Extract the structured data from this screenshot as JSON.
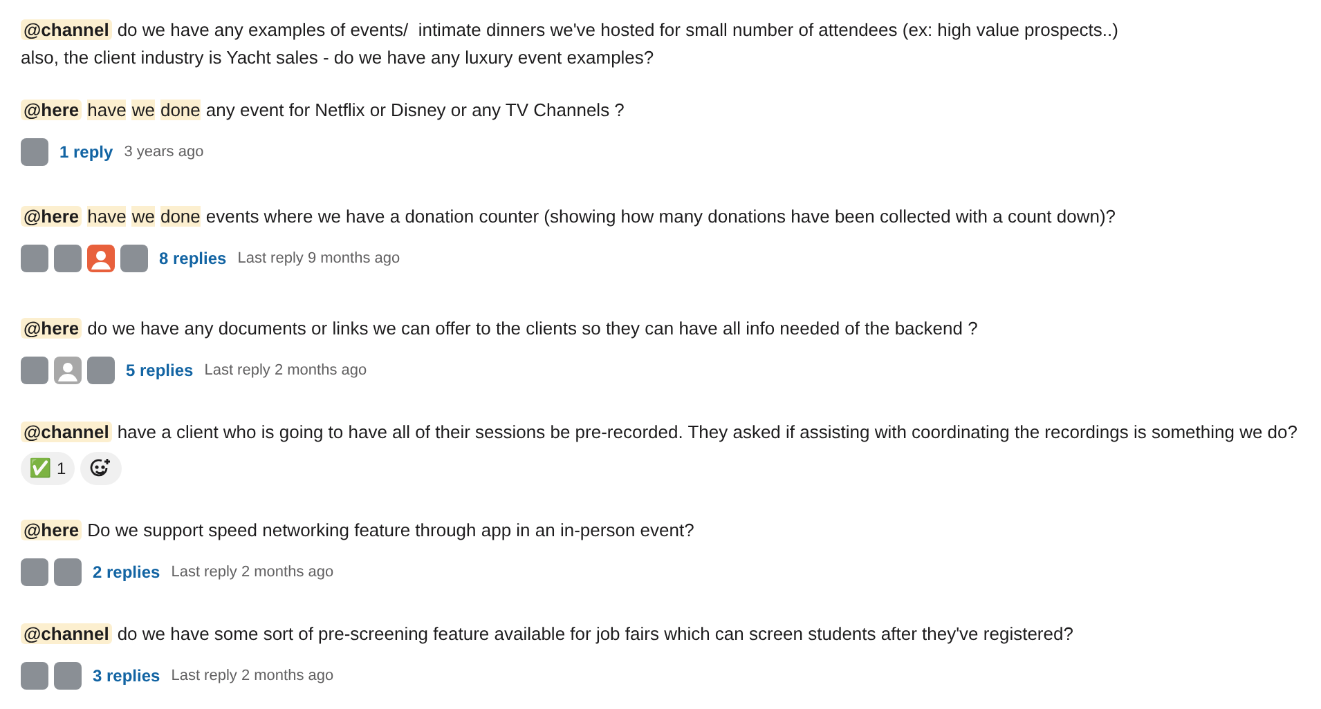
{
  "messages": [
    {
      "segments": [
        {
          "kind": "mention",
          "text": "@channel"
        },
        {
          "kind": "text",
          "text": "do we have any examples of events/  intimate dinners we've hosted for small number of attendees (ex: high value prospects..)\nalso, the client industry is Yacht sales - do we have any luxury event examples?"
        }
      ]
    },
    {
      "segments": [
        {
          "kind": "mention",
          "text": "@here"
        },
        {
          "kind": "highlight",
          "text": "have"
        },
        {
          "kind": "highlight",
          "text": "we"
        },
        {
          "kind": "highlight",
          "text": "done"
        },
        {
          "kind": "text",
          "text": "any event for Netflix or Disney or any TV Channels ?"
        }
      ],
      "thread": {
        "avatars": [
          {
            "kind": "photo"
          }
        ],
        "count": "1 reply",
        "last_reply": "3 years ago"
      }
    },
    {
      "segments": [
        {
          "kind": "mention",
          "text": "@here"
        },
        {
          "kind": "highlight",
          "text": "have"
        },
        {
          "kind": "highlight",
          "text": "we"
        },
        {
          "kind": "highlight",
          "text": "done"
        },
        {
          "kind": "text",
          "text": "events where we have a donation counter (showing how many donations have been collected with a count down)?"
        }
      ],
      "thread": {
        "avatars": [
          {
            "kind": "photo"
          },
          {
            "kind": "photo"
          },
          {
            "kind": "default",
            "color": "#e8603c"
          },
          {
            "kind": "photo"
          }
        ],
        "count": "8 replies",
        "last_reply": "Last reply 9 months ago"
      }
    },
    {
      "segments": [
        {
          "kind": "mention",
          "text": "@here"
        },
        {
          "kind": "text",
          "text": "do we have any documents or links we can offer to the clients so they can have all info needed of the backend ?"
        }
      ],
      "thread": {
        "avatars": [
          {
            "kind": "photo"
          },
          {
            "kind": "default",
            "color": "#a8a8a8"
          },
          {
            "kind": "photo"
          }
        ],
        "count": "5 replies",
        "last_reply": "Last reply 2 months ago"
      }
    },
    {
      "segments": [
        {
          "kind": "mention",
          "text": "@channel"
        },
        {
          "kind": "text",
          "text": "have a client who is going to have all of their sessions be pre-recorded. They asked if assisting with coordinating the recordings is something we do?"
        }
      ],
      "reactions": [
        {
          "emoji": "✅",
          "count": "1"
        }
      ]
    },
    {
      "segments": [
        {
          "kind": "mention",
          "text": "@here"
        },
        {
          "kind": "text",
          "text": "Do we support speed networking feature through app in an in-person event?"
        }
      ],
      "thread": {
        "avatars": [
          {
            "kind": "photo"
          },
          {
            "kind": "photo"
          }
        ],
        "count": "2 replies",
        "last_reply": "Last reply 2 months ago"
      }
    },
    {
      "segments": [
        {
          "kind": "mention",
          "text": "@channel"
        },
        {
          "kind": "text",
          "text": "do we have some sort of pre-screening feature available for job fairs which can screen students after they've registered?"
        }
      ],
      "thread": {
        "avatars": [
          {
            "kind": "photo"
          },
          {
            "kind": "photo"
          }
        ],
        "count": "3 replies",
        "last_reply": "Last reply 2 months ago"
      }
    }
  ]
}
